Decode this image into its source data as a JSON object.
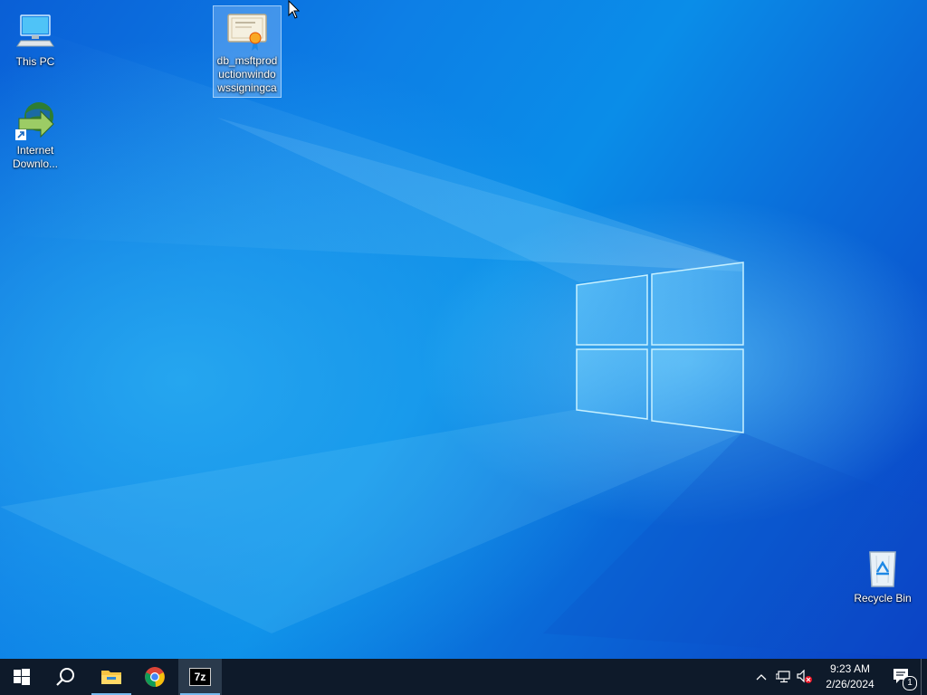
{
  "desktop": {
    "icons": [
      {
        "label": "This PC",
        "icon": "this-pc-icon"
      },
      {
        "label": "Internet\nDownlo...",
        "icon": "internet-download-manager-icon"
      },
      {
        "label": "db_msftprod\nuctionwindo\nwssigningca",
        "icon": "certificate-icon",
        "selected": true
      },
      {
        "label": "Recycle Bin",
        "icon": "recycle-bin-icon"
      }
    ]
  },
  "taskbar": {
    "apps": [
      {
        "name": "Start",
        "icon": "windows-start-icon"
      },
      {
        "name": "Search",
        "icon": "search-icon"
      },
      {
        "name": "File Explorer",
        "icon": "file-explorer-icon",
        "running": true
      },
      {
        "name": "Google Chrome",
        "icon": "chrome-icon"
      },
      {
        "name": "7-Zip",
        "icon": "7zip-icon",
        "running": true,
        "active": true,
        "glyph": "7z"
      }
    ],
    "tray": {
      "time": "9:23 AM",
      "date": "2/26/2024",
      "notification_count": "1"
    }
  },
  "colors": {
    "taskbar_bg": "#0e1a2a",
    "desktop_accent": "#0a7fe6",
    "running_indicator": "#76b9ed"
  }
}
